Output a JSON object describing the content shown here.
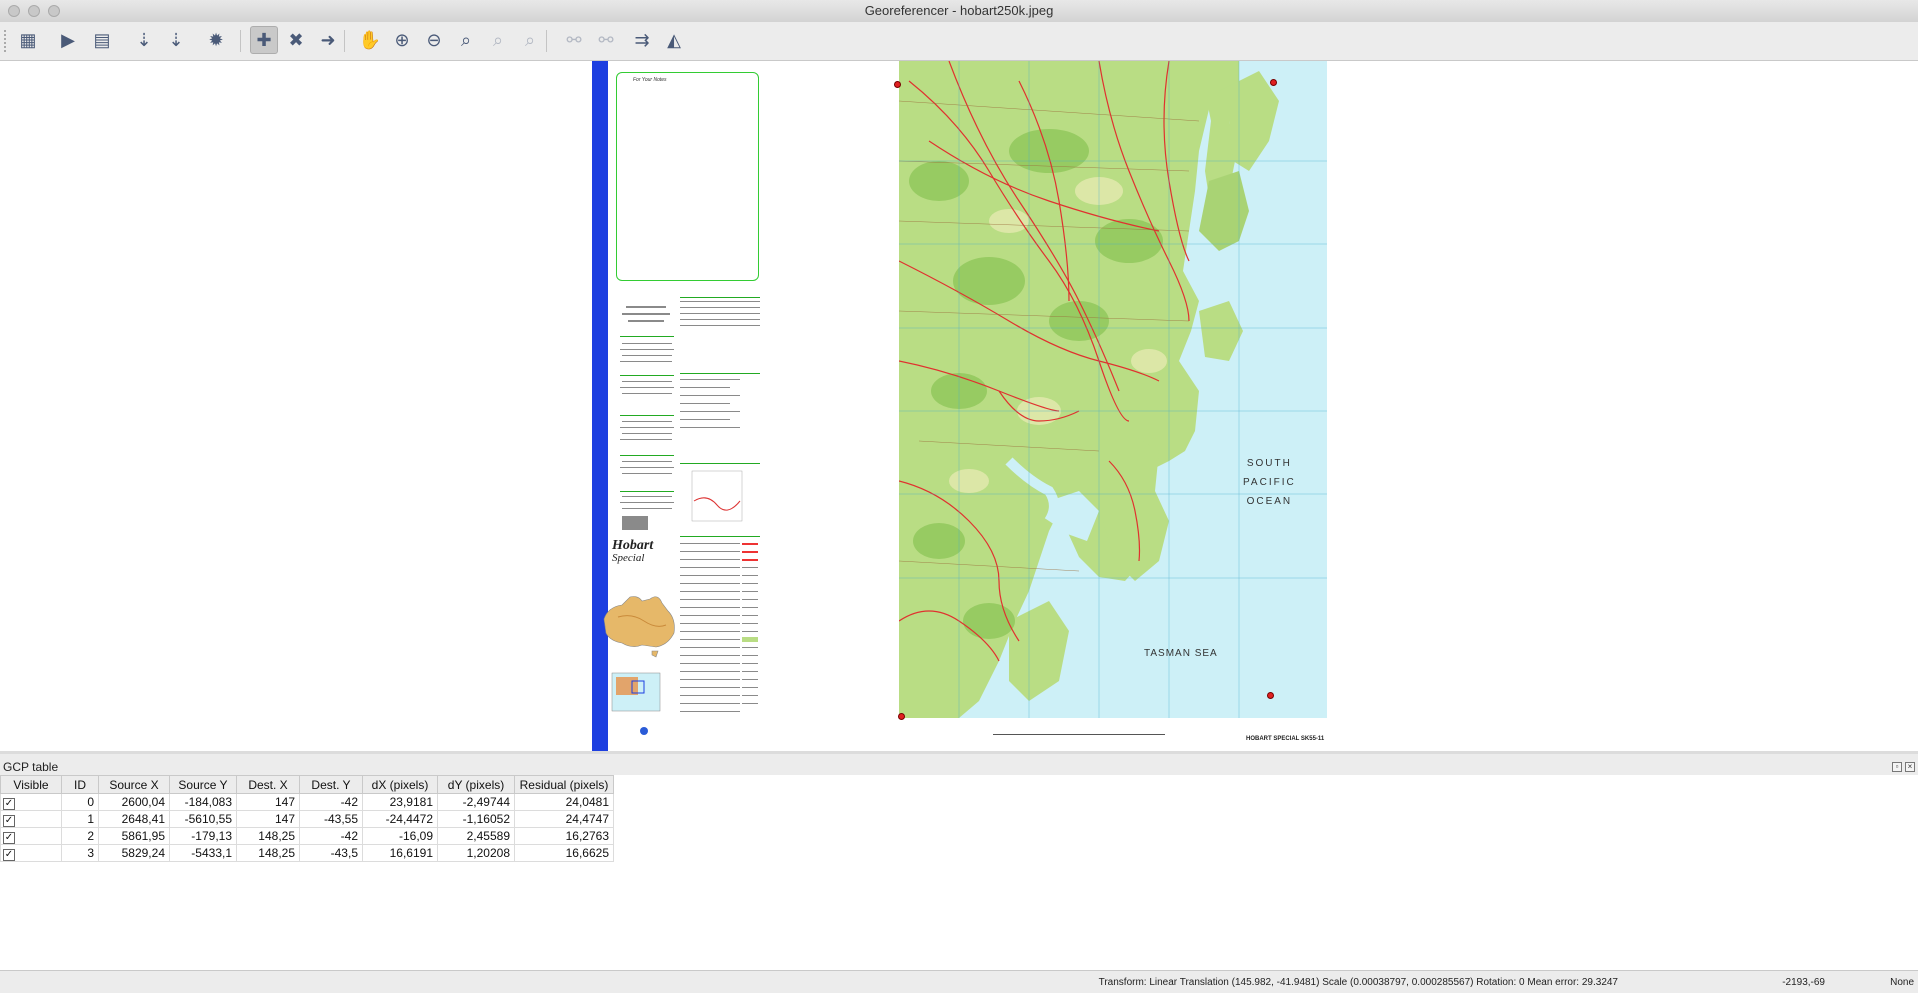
{
  "window": {
    "title": "Georeferencer - hobart250k.jpeg"
  },
  "toolbar": {
    "items": [
      {
        "name": "open-raster-icon",
        "glyph": "▦"
      },
      {
        "name": "start-georeferencing-icon",
        "glyph": "▶"
      },
      {
        "name": "generate-gdal-script-icon",
        "glyph": "▤"
      },
      {
        "name": "load-gcp-points-icon",
        "glyph": "⇣"
      },
      {
        "name": "save-gcp-points-icon",
        "glyph": "⇣"
      },
      {
        "name": "transformation-settings-icon",
        "glyph": "✹"
      },
      {
        "name": "add-point-icon",
        "glyph": "✚"
      },
      {
        "name": "delete-point-icon",
        "glyph": "✖"
      },
      {
        "name": "move-gcp-point-icon",
        "glyph": "➜"
      },
      {
        "name": "pan-icon",
        "glyph": "✋"
      },
      {
        "name": "zoom-in-icon",
        "glyph": "⊕"
      },
      {
        "name": "zoom-out-icon",
        "glyph": "⊖"
      },
      {
        "name": "zoom-to-layer-icon",
        "glyph": "⌕"
      },
      {
        "name": "zoom-last-icon",
        "glyph": "⌕"
      },
      {
        "name": "zoom-next-icon",
        "glyph": "⌕"
      },
      {
        "name": "link-georeferencer-to-qgis-icon",
        "glyph": "⚯"
      },
      {
        "name": "link-qgis-to-georeferencer-icon",
        "glyph": "⚯"
      },
      {
        "name": "full-histogram-stretch-icon",
        "glyph": "⇉"
      },
      {
        "name": "local-histogram-stretch-icon",
        "glyph": "◭"
      }
    ]
  },
  "map": {
    "ocean_labels": [
      "SOUTH",
      "PACIFIC",
      "OCEAN"
    ],
    "sea_label": "TASMAN SEA",
    "sheet_title": "Hobart",
    "sheet_subtitle": "Special",
    "notes_title": "For Your Notes",
    "caption": "HOBART SPECIAL SK55-11"
  },
  "gcp_panel": {
    "title": "GCP table",
    "columns": [
      "Visible",
      "ID",
      "Source X",
      "Source Y",
      "Dest. X",
      "Dest. Y",
      "dX (pixels)",
      "dY (pixels)",
      "Residual (pixels)"
    ],
    "rows": [
      {
        "visible": "✓",
        "id": "0",
        "source_x": "2600,04",
        "source_y": "-184,083",
        "dest_x": "147",
        "dest_y": "-42",
        "dx": "23,9181",
        "dy": "-2,49744",
        "residual": "24,0481"
      },
      {
        "visible": "✓",
        "id": "1",
        "source_x": "2648,41",
        "source_y": "-5610,55",
        "dest_x": "147",
        "dest_y": "-43,55",
        "dx": "-24,4472",
        "dy": "-1,16052",
        "residual": "24,4747"
      },
      {
        "visible": "✓",
        "id": "2",
        "source_x": "5861,95",
        "source_y": "-179,13",
        "dest_x": "148,25",
        "dest_y": "-42",
        "dx": "-16,09",
        "dy": "2,45589",
        "residual": "16,2763"
      },
      {
        "visible": "✓",
        "id": "3",
        "source_x": "5829,24",
        "source_y": "-5433,1",
        "dest_x": "148,25",
        "dest_y": "-43,5",
        "dx": "16,6191",
        "dy": "1,20208",
        "residual": "16,6625"
      }
    ]
  },
  "status": {
    "transform": "Transform: Linear Translation (145.982, -41.9481) Scale (0.00038797, 0.000285567) Rotation: 0 Mean error: 29.3247",
    "coords": "-2193,-69",
    "crs": "None"
  },
  "colors": {
    "land": "#b9dd84",
    "water": "#cdf0f7",
    "roads": "#e0312f",
    "blue_strip": "#1d3fe0",
    "gcp_marker": "#e02020"
  }
}
